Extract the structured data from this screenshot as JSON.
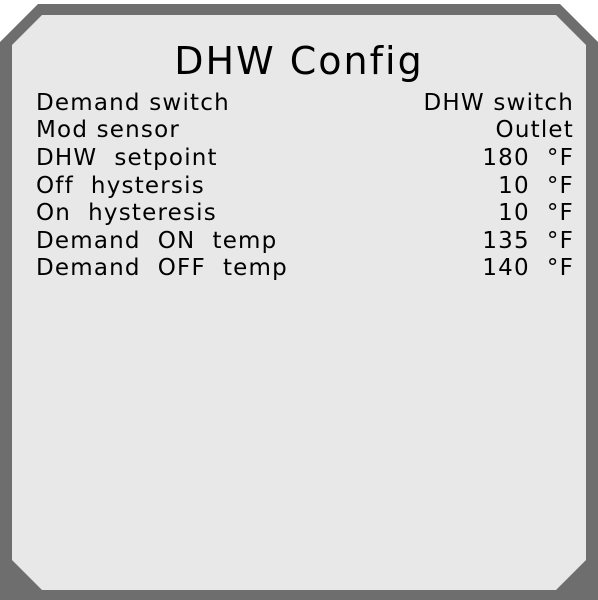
{
  "screen": {
    "title": "DHW Config",
    "colors": {
      "bezel": "#6e6e6e",
      "screen_bg": "#e8e8e8",
      "text": "#000000"
    }
  },
  "rows": [
    {
      "label": "Demand switch",
      "value": "DHW switch"
    },
    {
      "label": "Mod sensor",
      "value": "Outlet"
    },
    {
      "label": "DHW  setpoint",
      "value": "180  °F"
    },
    {
      "label": "Off  hystersis",
      "value": "10  °F"
    },
    {
      "label": "On  hysteresis",
      "value": "10  °F"
    },
    {
      "label": "Demand  ON  temp",
      "value": "135  °F"
    },
    {
      "label": "Demand  OFF  temp",
      "value": "140  °F"
    }
  ]
}
